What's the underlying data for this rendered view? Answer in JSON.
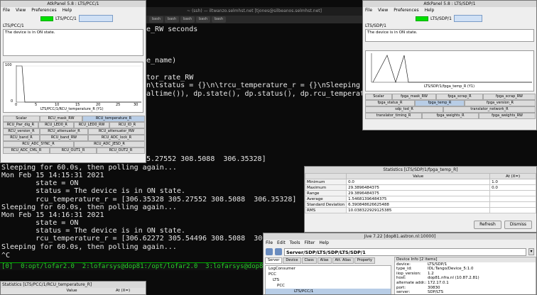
{
  "terminal": {
    "title": "~ (ssh) — iltwanzo.selmhst.net [tjones@silbeanos.selmhst.net]",
    "tabs": [
      "bash",
      "bash",
      "bash",
      "bash",
      "bash"
    ],
    "lines": [
      "te_RW seconds",
      "",
      "",
      "ce_name)",
      "",
      "itor_rate_RW",
      "\\n\\tstatus = {}\\n\\trcu_temperature_r = {}\\nSleeping for {}s,",
      "caltime()), dp.state(), dp.status(), dp.rcu_temperature_r[0:",
      "",
      "",
      "",
      "",
      ".",
      "05.27552 308.5088  306.35328]"
    ],
    "lower_lines": [
      "Sleeping for 60.0s, then polling again...",
      "Mon Feb 15 14:15:31 2021",
      "        state = ON",
      "        status = The device is in ON state.",
      "        rcu_temperature_r = [306.35328 305.27552 308.5088  306.35328]",
      "Sleeping for 60.0s, then polling again...",
      "Mon Feb 15 14:16:31 2021",
      "        state = ON",
      "        status = The device is in ON state.",
      "        rcu_temperature_r = [306.62272 305.54496 308.5088  306.62272]",
      "Sleeping for 60.0s, then polling again...",
      "^C"
    ],
    "tmux_bar": "[0]  0:opt/lofar2.0  2:lofarsys@dop81:/opt/lofar2.0  3:lofarsys@dop8"
  },
  "pcc_panel": {
    "title": "AtkPanel 5.8 : LTS/PCC/1",
    "menu": [
      "File",
      "View",
      "Preferences",
      "Help"
    ],
    "device": "LTS/PCC/1",
    "state_label": "LTS/PCC/1",
    "status_text": "The device is in ON state.",
    "plot_ymax": "100",
    "plot_y0": "0",
    "plot_xticks": [
      "0",
      "5",
      "10",
      "15",
      "20",
      "25",
      "30"
    ],
    "plot_legend": "LTS/PCC/1/RCU_temperature_R (Y1)",
    "buttons": [
      "Scalar",
      "RCU_mask_RW",
      "RCU_temperature_R",
      "RCU_Pwr_dig_R",
      "RCU_LED0_R",
      "RCU_LED0_RW",
      "RCU_ID_R",
      "RCU_version_R",
      "RCU_attenuator_R",
      "RCU_attenuator_RW",
      "RCU_band_R",
      "RCU_band_RW",
      "RCU_ADC_lock_R",
      "RCU_ADC_SYNC_R",
      "RCU_ADC_JESD_R",
      "RCU_ADC_CML_R",
      "RCU_OUT1_R",
      "RCU_OUT2_R"
    ]
  },
  "sdp_panel": {
    "title": "AtkPanel 5.8 : LTS/SDP/1",
    "menu": [
      "File",
      "View",
      "Preferences",
      "Help"
    ],
    "device": "LTS/SDP/1",
    "state_label": "LTS/SDP/1",
    "status_text": "The device is in ON state.",
    "plot_legend": "LTS/SDP/1/fpga_temp_R (Y1)",
    "buttons": [
      "Scalar",
      "fpga_mask_RW",
      "fpga_scrap_R",
      "fpga_scrap_RW",
      "fpga_status_R",
      "fpga_temp_R",
      "fpga_version_R",
      "sdp_tod_R",
      "translator_network_R",
      "translator_timing_R",
      "fpga_weights_R",
      "fpga_weights_RW"
    ]
  },
  "stats": {
    "title": "Statistics [LTS/SDP/1/fpga_temp_R]",
    "col_value": "Value",
    "col_at": "At (X=)",
    "rows": [
      {
        "k": "Minimum",
        "v": "0.0",
        "at": "1.0"
      },
      {
        "k": "Maximum",
        "v": "29.3896484375",
        "at": "0.0"
      },
      {
        "k": "Range",
        "v": "29.3896484375",
        "at": ""
      },
      {
        "k": "Average",
        "v": "1.5468139648437​5",
        "at": ""
      },
      {
        "k": "Standard Deviation",
        "v": "6.390848626625488",
        "at": ""
      },
      {
        "k": "RMS",
        "v": "10.03832292912​5385",
        "at": ""
      }
    ],
    "refresh": "Refresh",
    "dismiss": "Dismiss"
  },
  "jive": {
    "title": "Jive 7.22 [dop81.astron.nl:10000]",
    "menu": [
      "File",
      "Edit",
      "Tools",
      "Filter",
      "Help"
    ],
    "address": "Server/SDP/LTS/SDP/LTS/SDP/1",
    "tabs": [
      "Server",
      "Device",
      "Class",
      "Alias",
      "Att. Alias",
      "Property"
    ],
    "tree": [
      "LogConsumer",
      "PCC",
      "LTS",
      "PCC",
      "LTS/PCC/1"
    ],
    "info_header": "Device Info [2 items]",
    "info": [
      {
        "k": "device:",
        "v": "LTS/SDP/1"
      },
      {
        "k": "type_id:",
        "v": "IDL:Tango/Device_5:1.0"
      },
      {
        "k": "iiop_version:",
        "v": "1.2"
      },
      {
        "k": "host:",
        "v": "dop81.nfra.nl (10.87.2.81)"
      },
      {
        "k": "alternate addr.:",
        "v": "172.17.0.1"
      },
      {
        "k": "port:",
        "v": "30830"
      },
      {
        "k": "server:",
        "v": "SDP/LTS"
      }
    ]
  },
  "stats_bottom": {
    "title": "Statistics [LTS/PCC/1/RCU_temperature_R]",
    "col_value": "Value",
    "col_at": "At (X=)"
  }
}
